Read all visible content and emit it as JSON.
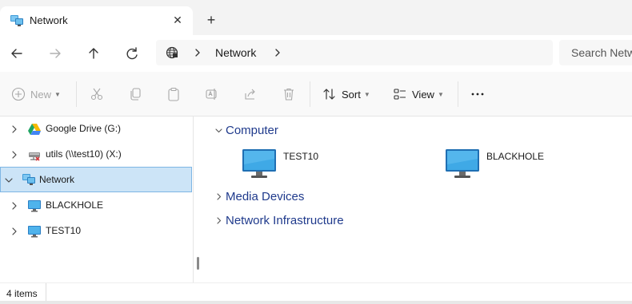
{
  "tab": {
    "title": "Network",
    "icon": "network-icon",
    "close_icon": "close-icon"
  },
  "new_tab_icon": "plus-icon",
  "navigation": {
    "back_icon": "arrow-left-icon",
    "forward_icon": "arrow-right-icon",
    "up_icon": "arrow-up-icon",
    "refresh_icon": "refresh-icon"
  },
  "address": {
    "location_icon": "globe-icon",
    "crumb": "Network"
  },
  "search": {
    "placeholder": "Search Netw"
  },
  "commands": {
    "new": "New",
    "sort": "Sort",
    "view": "View",
    "more_icon": "more-icon"
  },
  "nav_pane": {
    "items": [
      {
        "label": "Google Drive (G:)",
        "icon": "google-drive-icon",
        "expanded": false,
        "selected": false
      },
      {
        "label": "utils (\\\\test10) (X:)",
        "icon": "network-drive-disconnected-icon",
        "expanded": false,
        "selected": false
      },
      {
        "label": "Network",
        "icon": "network-icon",
        "expanded": true,
        "selected": true
      },
      {
        "label": "BLACKHOLE",
        "icon": "computer-icon",
        "expanded": false,
        "selected": false
      },
      {
        "label": "TEST10",
        "icon": "computer-icon",
        "expanded": false,
        "selected": false
      }
    ]
  },
  "content": {
    "groups": [
      {
        "title": "Computer",
        "expanded": true,
        "items": [
          "TEST10",
          "BLACKHOLE"
        ]
      },
      {
        "title": "Media Devices",
        "expanded": false
      },
      {
        "title": "Network Infrastructure",
        "expanded": false
      }
    ]
  },
  "status": {
    "count": "4 items"
  },
  "colors": {
    "accent": "#0067c0",
    "selection_bg": "#cce4f7",
    "selection_border": "#7eb6e4",
    "group_title": "#1f3a8c"
  }
}
